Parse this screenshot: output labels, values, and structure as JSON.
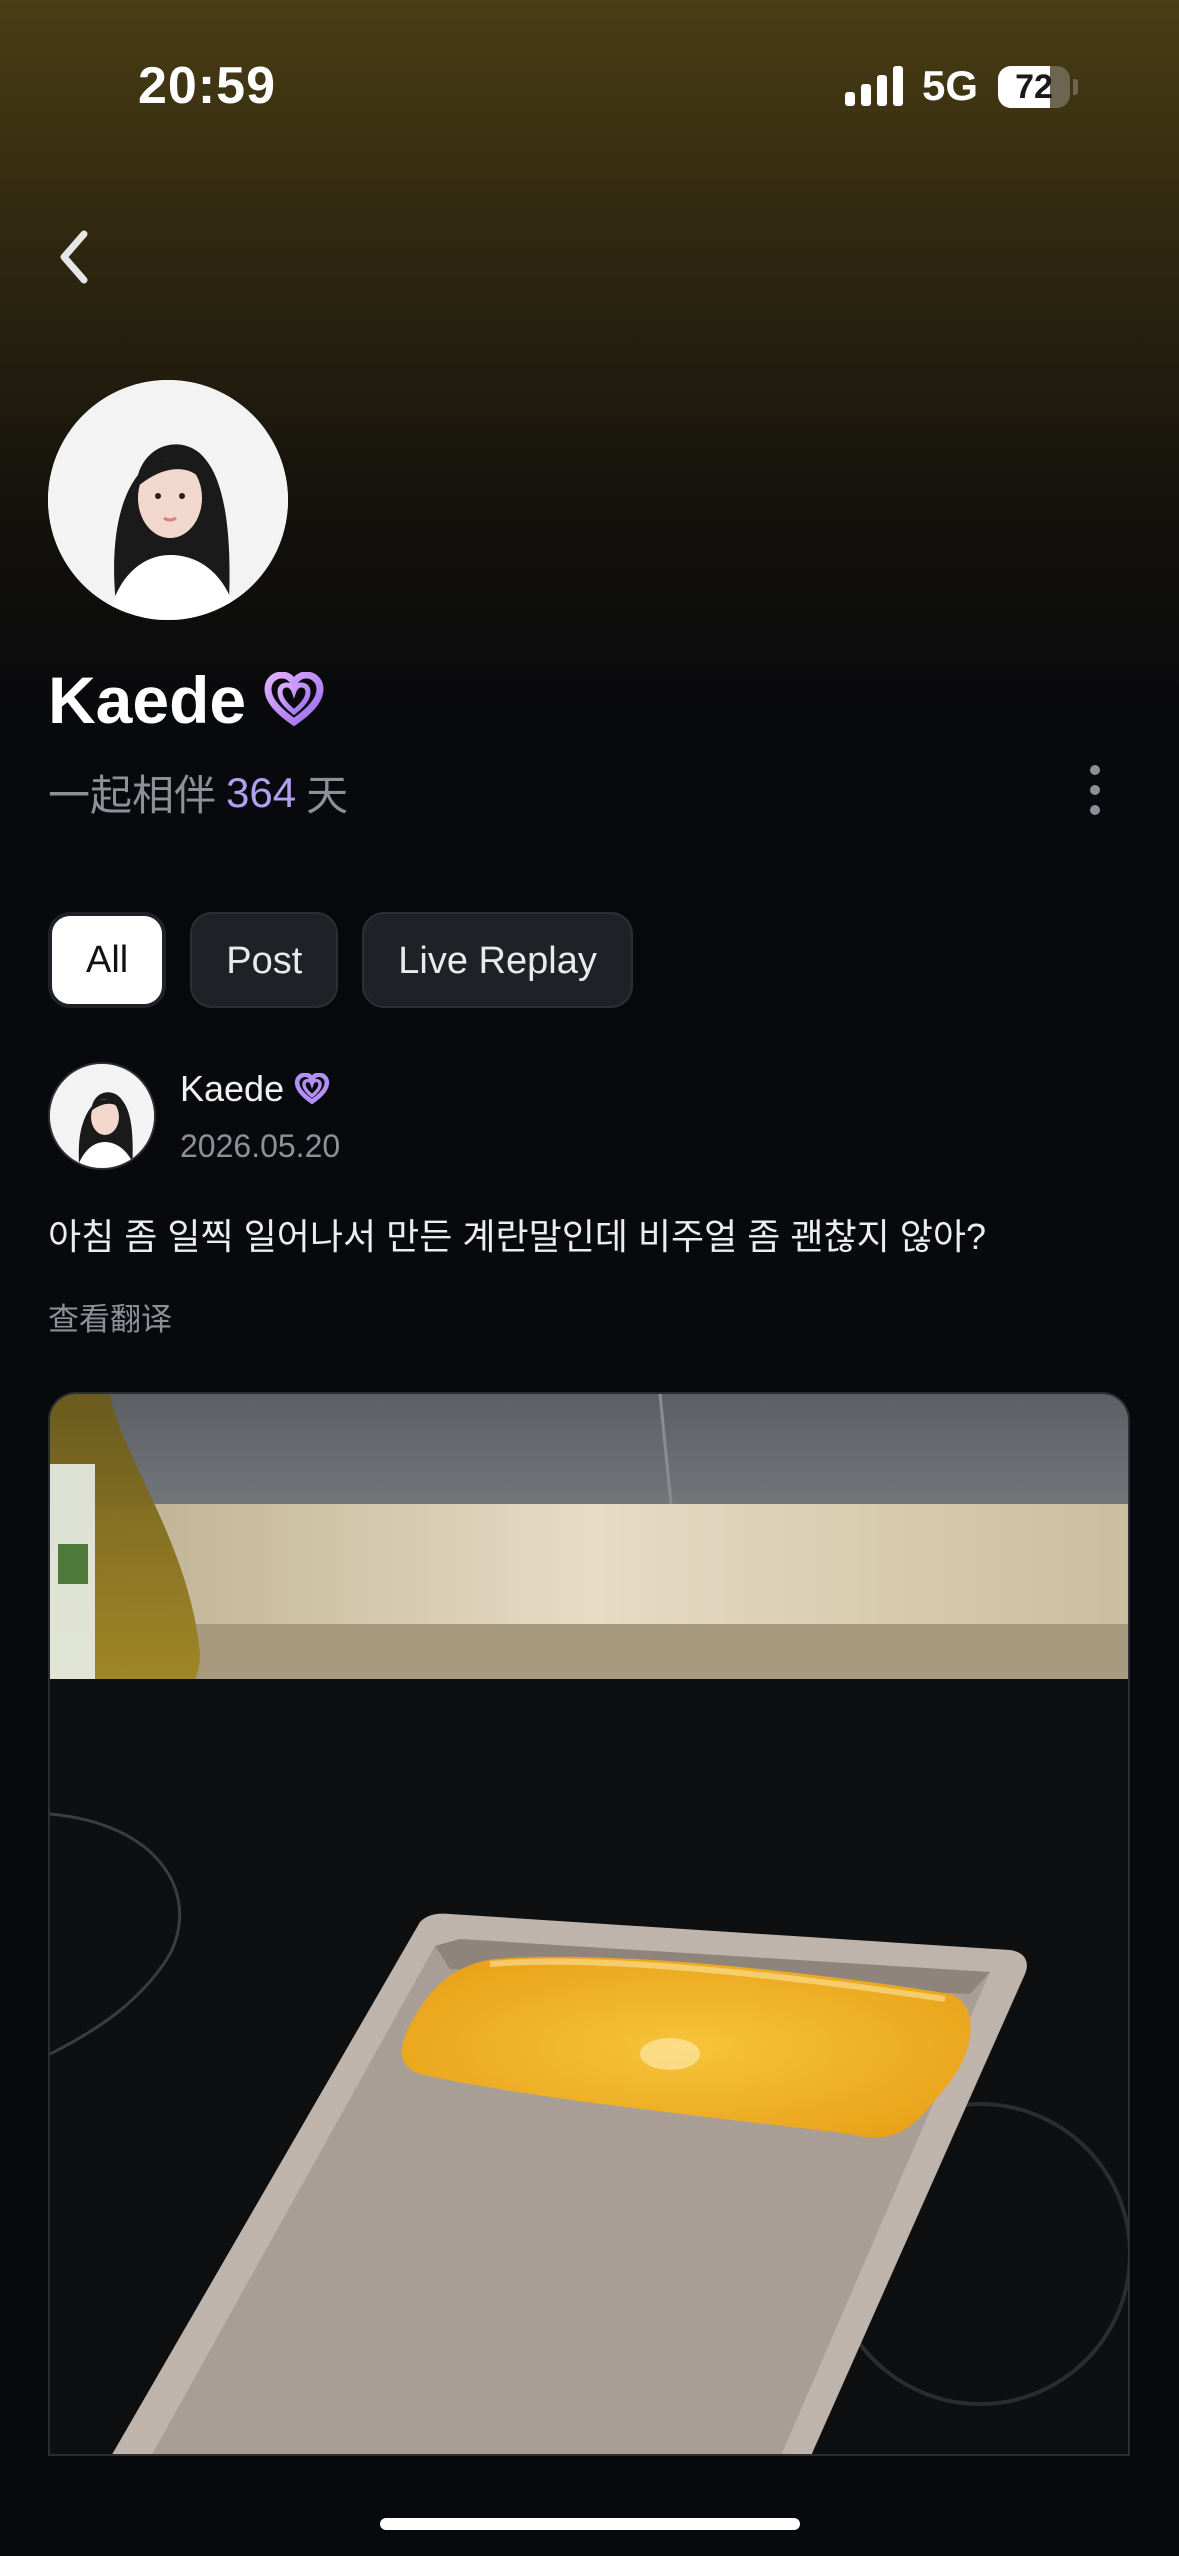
{
  "status_bar": {
    "time": "20:59",
    "network": "5G",
    "battery": "72",
    "battery_level": 0.72
  },
  "profile": {
    "name": "Kaede",
    "days_prefix": "一起相伴",
    "days_count": "364",
    "days_suffix": "天"
  },
  "tabs": [
    {
      "label": "All",
      "active": true
    },
    {
      "label": "Post",
      "active": false
    },
    {
      "label": "Live Replay",
      "active": false
    }
  ],
  "post": {
    "author": "Kaede",
    "date": "2026.05.20",
    "text": "아침 좀 일찍 일어나서 만든 계란말인데 비주얼 좀 괜찮지 않아?",
    "translate_label": "查看翻译"
  },
  "colors": {
    "accent": "#b39ff2",
    "background": "#08090c",
    "header_gradient_top": "#4a3d14"
  },
  "icons": {
    "back": "chevron-left-icon",
    "badge": "heart-badge-icon",
    "more": "more-vertical-icon"
  }
}
